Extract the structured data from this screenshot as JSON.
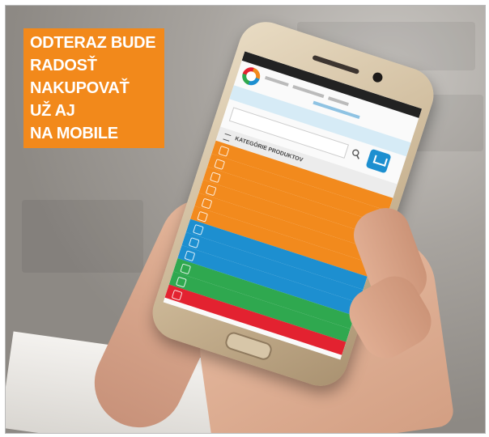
{
  "headline": {
    "lines": [
      "ODTERAZ BUDE",
      "RADOSŤ",
      "NAKUPOVAŤ",
      "UŽ AJ",
      "NA MOBILE"
    ]
  },
  "colors": {
    "headline_bg": "#f2891b",
    "orange": "#f28a1d",
    "blue": "#1d8fd0",
    "green": "#2fa84f",
    "red": "#e32230"
  },
  "phone": {
    "screen": {
      "categories_header": "KATEGÓRIE PRODUKTOV",
      "icons": [
        "logo-icon",
        "search-icon",
        "cart-icon",
        "menu-icon"
      ]
    },
    "categories": [
      {
        "color": "orange",
        "icon": "leaf-icon"
      },
      {
        "color": "orange",
        "icon": "flower-icon"
      },
      {
        "color": "orange",
        "icon": "house-icon"
      },
      {
        "color": "orange",
        "icon": "pot-icon"
      },
      {
        "color": "orange",
        "icon": "bottle-icon"
      },
      {
        "color": "orange",
        "icon": "box-icon"
      },
      {
        "color": "blue",
        "icon": "drill-icon"
      },
      {
        "color": "blue",
        "icon": "pipe-icon"
      },
      {
        "color": "blue",
        "icon": "wrench-icon"
      },
      {
        "color": "green",
        "icon": "animal-icon"
      },
      {
        "color": "green",
        "icon": "tractor-icon"
      },
      {
        "color": "red",
        "icon": "tag-icon"
      }
    ]
  }
}
